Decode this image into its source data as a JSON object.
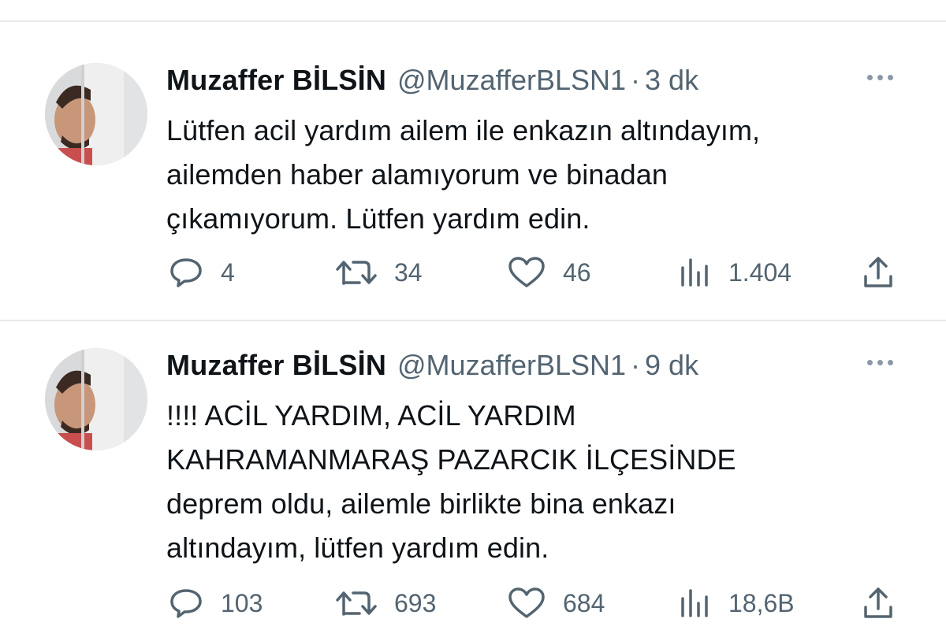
{
  "tweets": [
    {
      "display_name": "Muzaffer BİLSİN",
      "handle": "@MuzafferBLSN1",
      "separator": "·",
      "time": "3 dk",
      "text_lines": [
        "Lütfen acil yardım ailem ile enkazın altındayım,",
        "ailemden haber alamıyorum ve binadan",
        "çıkamıyorum. Lütfen yardım edin."
      ],
      "replies": "4",
      "retweets": "34",
      "likes": "46",
      "views": "1.404"
    },
    {
      "display_name": "Muzaffer BİLSİN",
      "handle": "@MuzafferBLSN1",
      "separator": "·",
      "time": "9 dk",
      "text_lines": [
        "!!!! ACİL YARDIM, ACİL YARDIM",
        "KAHRAMANMARAŞ PAZARCIK İLÇESİNDE",
        "deprem oldu, ailemle birlikte bina enkazı",
        "altındayım, lütfen yardım edin."
      ],
      "replies": "103",
      "retweets": "693",
      "likes": "684",
      "views": "18,6B"
    }
  ],
  "icons": {
    "reply": "reply-icon",
    "retweet": "retweet-icon",
    "like": "heart-icon",
    "views": "views-icon",
    "share": "share-icon",
    "more": "more-icon"
  },
  "colors": {
    "text": "#0f1419",
    "secondary": "#536471",
    "divider": "#e7e9ea"
  }
}
